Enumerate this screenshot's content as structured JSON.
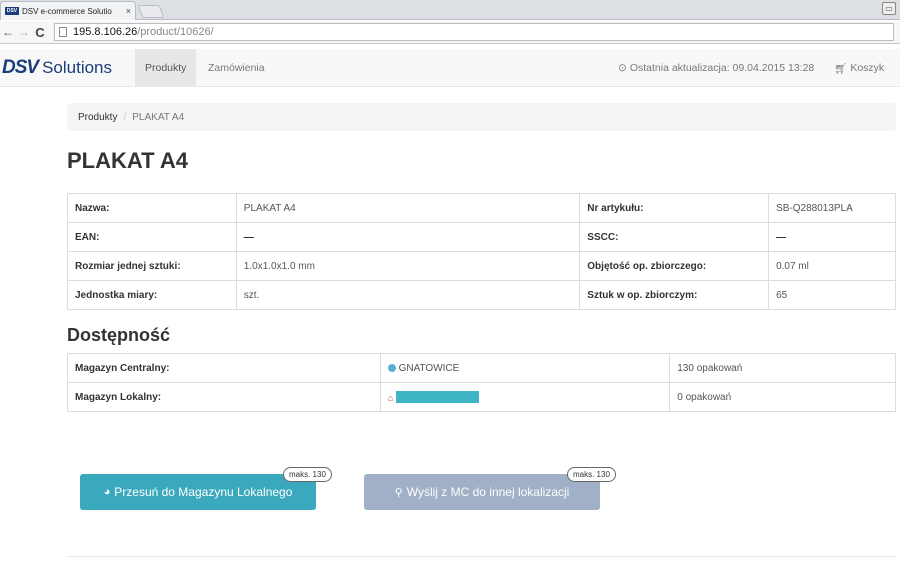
{
  "browser": {
    "tab_title": "DSV e-commerce Solutio",
    "tab_favicon": "DSV",
    "tab_close": "×",
    "url_host": "195.8.106.26",
    "url_path": "/product/10626/",
    "back": "←",
    "forward": "→",
    "reload": "C"
  },
  "navbar": {
    "brand_dsv": "DSV",
    "brand_solutions": "Solutions",
    "items": [
      {
        "label": "Produkty",
        "active": true
      },
      {
        "label": "Zamówienia",
        "active": false
      }
    ],
    "last_update": "Ostatnia aktualizacja: 09.04.2015 13:28",
    "cart": "Koszyk"
  },
  "breadcrumb": {
    "items": [
      "Produkty",
      "PLAKAT A4"
    ],
    "separator": "/"
  },
  "page_title": "PLAKAT A4",
  "details": [
    [
      {
        "label": "Nazwa:",
        "value": "PLAKAT A4"
      },
      {
        "label": "Nr artykułu:",
        "value": "SB-Q288013PLA"
      }
    ],
    [
      {
        "label": "EAN:",
        "value": "—"
      },
      {
        "label": "SSCC:",
        "value": "—"
      }
    ],
    [
      {
        "label": "Rozmiar jednej sztuki:",
        "value": "1.0x1.0x1.0 mm"
      },
      {
        "label": "Objętość op. zbiorczego:",
        "value": "0.07 ml"
      }
    ],
    [
      {
        "label": "Jednostka miary:",
        "value": "szt."
      },
      {
        "label": "Sztuk w op. zbiorczym:",
        "value": "65"
      }
    ]
  ],
  "availability": {
    "title": "Dostępność",
    "rows": [
      {
        "label": "Magazyn Centralny:",
        "location": "GNATOWICE",
        "count": "130 opakowań"
      },
      {
        "label": "Magazyn Lokalny:",
        "location": "",
        "count": "0 opakowań"
      }
    ]
  },
  "buttons": {
    "move_label": "Przesuń do Magazynu Lokalnego",
    "move_badge": "maks. 130",
    "send_label": "Wyślij z MC do innej lokalizacji",
    "send_badge": "maks. 130"
  },
  "colors": {
    "brand": "#1b3c7a",
    "primary_button": "#3ba9bd",
    "disabled_button": "#9fb0c7",
    "danger_text": "#a94442"
  }
}
